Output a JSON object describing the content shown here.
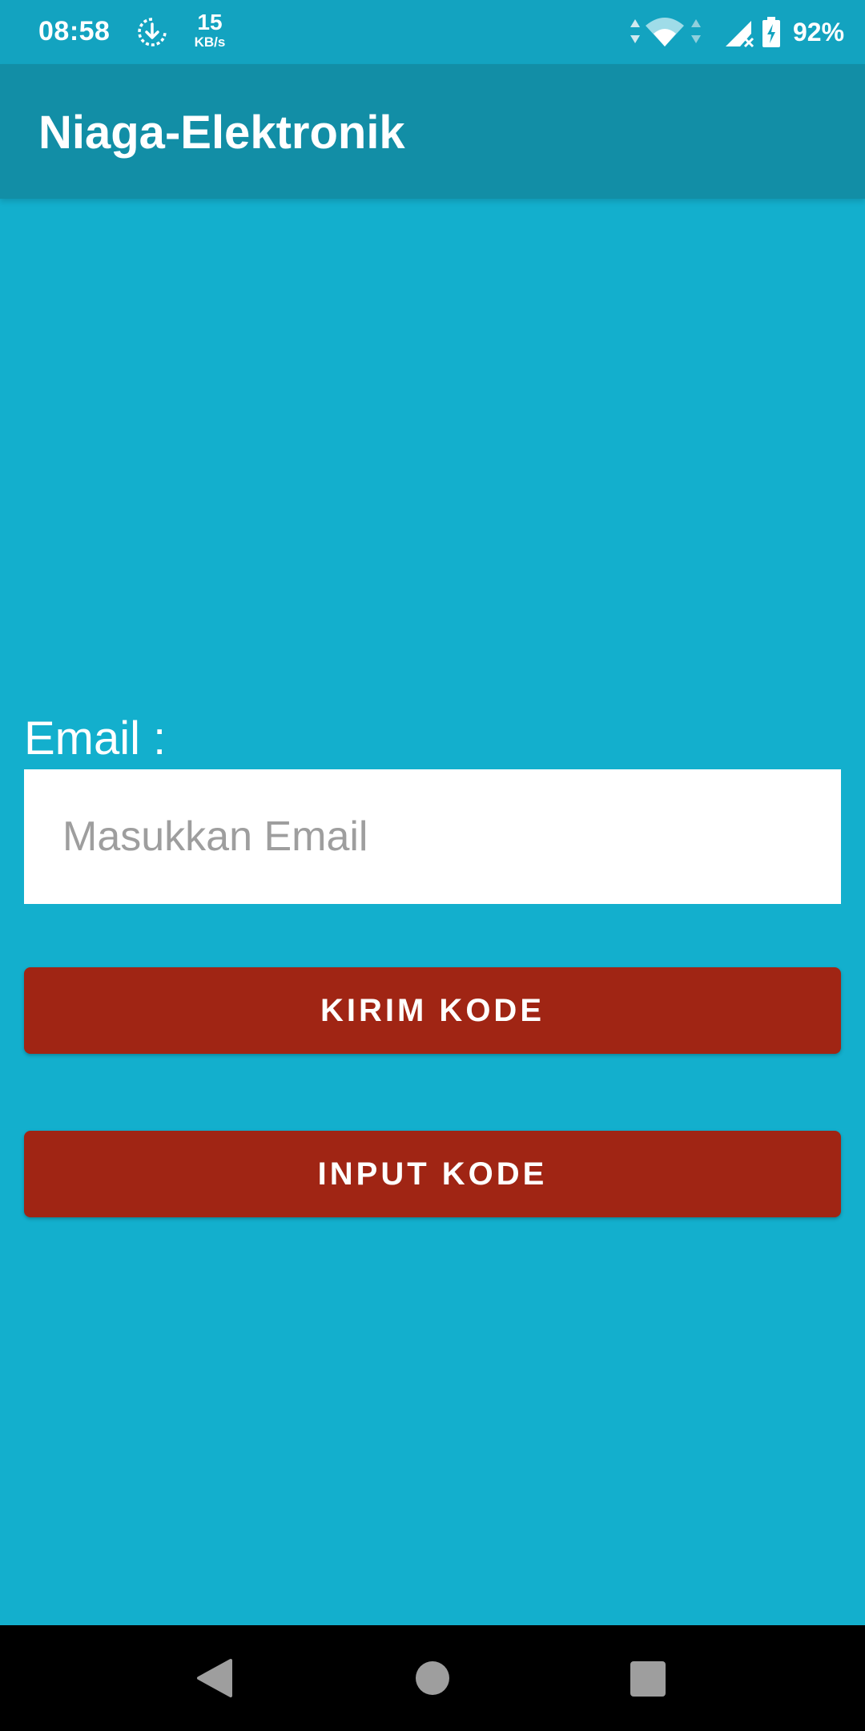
{
  "status_bar": {
    "time": "08:58",
    "speed_value": "15",
    "speed_unit": "KB/s",
    "battery": "92%",
    "icons": [
      "sync-icon",
      "data-arrows-icon",
      "wifi-icon",
      "signal-icon",
      "battery-charging-icon"
    ]
  },
  "app_bar": {
    "title": "Niaga-Elektronik"
  },
  "form": {
    "email_label": "Email :",
    "email_value": "",
    "email_placeholder": "Masukkan Email",
    "send_code_label": "KIRIM KODE",
    "input_code_label": "INPUT KODE"
  },
  "nav_bar": {
    "icons": [
      "back-icon",
      "home-icon",
      "recents-icon"
    ]
  },
  "colors": {
    "background": "#13afcd",
    "app_bar": "#128ea6",
    "status_bar": "#13a3c0",
    "button": "#a02514",
    "nav_bar": "#000000"
  }
}
